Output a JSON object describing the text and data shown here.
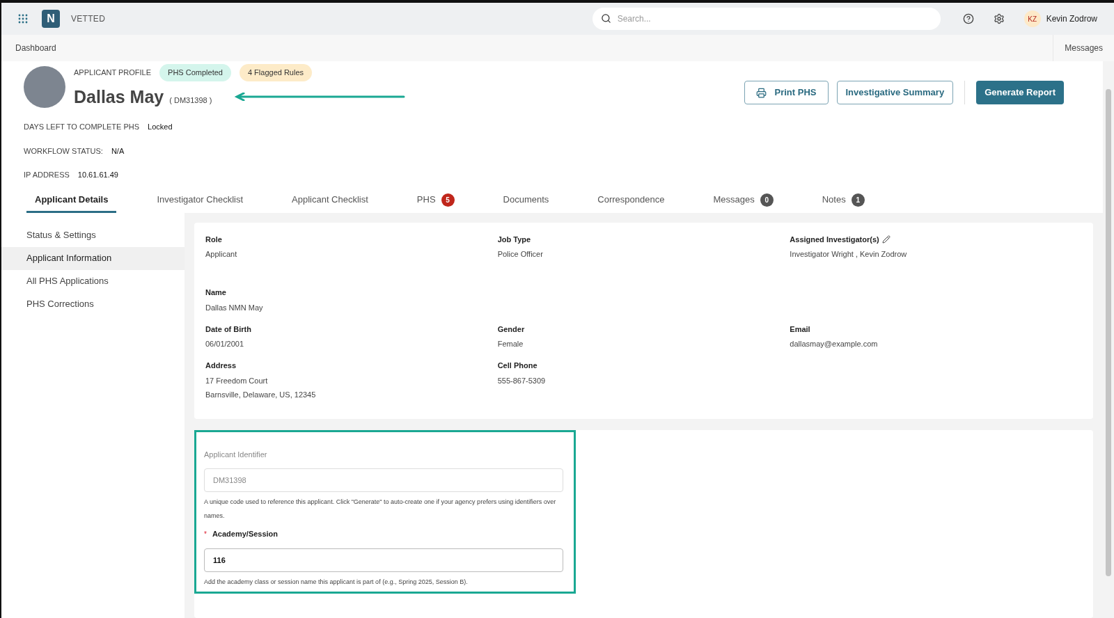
{
  "topbar": {
    "brand_letter": "N",
    "brand": "VETTED",
    "search": {
      "placeholder": "Search..."
    },
    "user": {
      "initials": "KZ",
      "name": "Kevin Zodrow"
    }
  },
  "breadcrumb": {
    "items": [
      "Dashboard"
    ],
    "right_link": "Messages"
  },
  "profile": {
    "label": "APPLICANT PROFILE",
    "badges": [
      {
        "text": "PHS Completed",
        "color": "#d4f5ec"
      },
      {
        "text": "4 Flagged Rules",
        "color": "#fdebc8"
      }
    ],
    "name": "Dallas May",
    "code": "( DM31398 )",
    "facts": [
      {
        "label": "DAYS LEFT TO COMPLETE PHS",
        "value": "Locked"
      },
      {
        "label": "WORKFLOW STATUS:",
        "value": "N/A"
      },
      {
        "label": "IP ADDRESS",
        "value": "10.61.61.49"
      }
    ]
  },
  "actions": [
    {
      "kind": "print",
      "label": "Print PHS"
    },
    {
      "kind": "outline",
      "label": "Investigative Summary"
    },
    {
      "kind": "primary",
      "label": "Generate Report"
    }
  ],
  "tabs": [
    {
      "label": "Applicant Details",
      "selected": true
    },
    {
      "label": "Investigator Checklist",
      "selected": false
    },
    {
      "label": "Applicant Checklist",
      "selected": false
    },
    {
      "label": "PHS",
      "selected": false,
      "count": "5",
      "color": "#c0261b"
    },
    {
      "label": "Documents",
      "selected": false
    },
    {
      "label": "Correspondence",
      "selected": false
    },
    {
      "label": "Messages",
      "selected": false,
      "count": "0",
      "color": "#555555"
    },
    {
      "label": "Notes",
      "selected": false,
      "count": "1",
      "color": "#555555"
    }
  ],
  "sidebar": {
    "items": [
      {
        "label": "Status & Settings",
        "selected": false
      },
      {
        "label": "Applicant Information",
        "selected": true
      },
      {
        "label": "All PHS Applications",
        "selected": false
      },
      {
        "label": "PHS Corrections",
        "selected": false
      }
    ]
  },
  "details": {
    "rows": [
      [
        {
          "label": "Role",
          "values": [
            "Applicant"
          ]
        },
        {
          "label": "Job Type",
          "values": [
            "Police Officer"
          ]
        },
        {
          "label": "Assigned Investigator(s)",
          "editable": true,
          "values": [
            "Investigator Wright ,  Kevin Zodrow"
          ]
        }
      ],
      [
        {
          "label": "Name",
          "values": [
            "Dallas NMN May"
          ]
        }
      ],
      [
        {
          "label": "Date of Birth",
          "values": [
            "06/01/2001"
          ]
        },
        {
          "label": "Gender",
          "values": [
            "Female"
          ]
        },
        {
          "label": "Email",
          "values": [
            "dallasmay@example.com"
          ]
        }
      ],
      [
        {
          "label": "Address",
          "values": [
            "17 Freedom Court",
            "Barnsville, Delaware, US, 12345"
          ]
        },
        {
          "label": "Cell Phone",
          "values": [
            "555-867-5309"
          ]
        }
      ]
    ]
  },
  "form": {
    "fields": [
      {
        "label": "Applicant Identifier",
        "value": "DM31398",
        "disabled": true,
        "required": false,
        "help": "A unique code used to reference this applicant. Click \"Generate\" to auto-create one if your agency prefers using identifiers over names."
      },
      {
        "label": "Academy/Session",
        "value": "116",
        "disabled": false,
        "required": true,
        "required_mark": "*",
        "help": "Add the academy class or session name this applicant is part of (e.g., Spring 2025, Session B)."
      }
    ]
  }
}
